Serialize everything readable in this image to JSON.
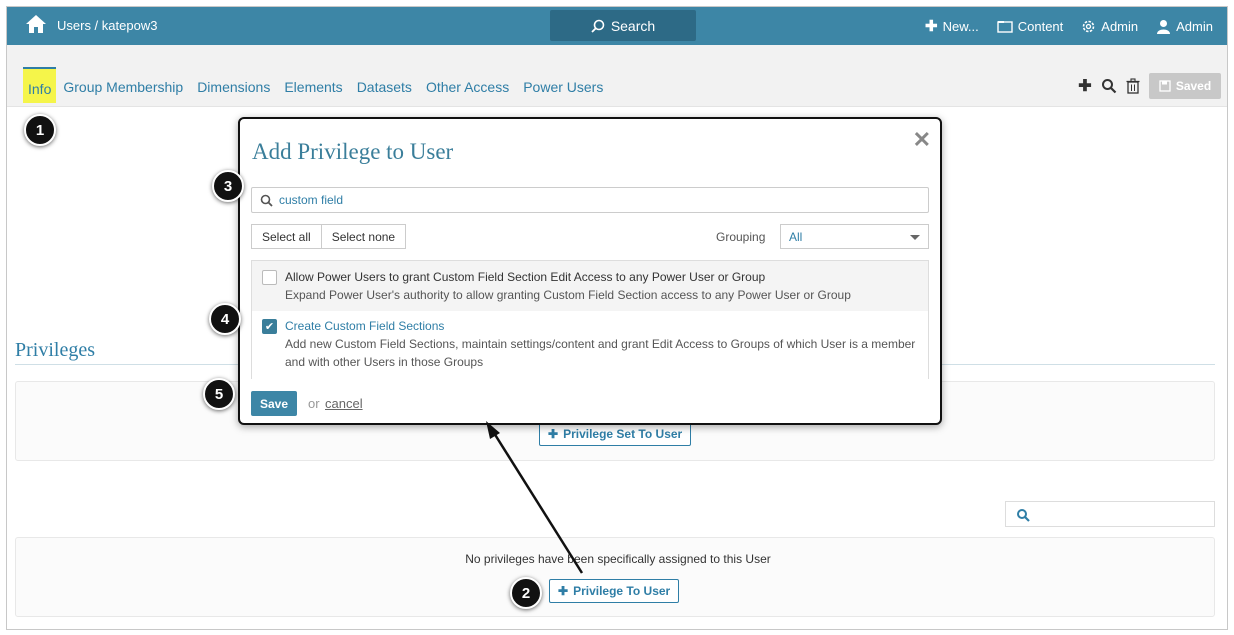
{
  "topbar": {
    "breadcrumb": "Users / katepow3",
    "search_label": "Search",
    "new_label": "New...",
    "content_label": "Content",
    "admin_label": "Admin",
    "user_label": "Admin"
  },
  "tabs": [
    {
      "label": "Info",
      "active": true
    },
    {
      "label": "Group Membership"
    },
    {
      "label": "Dimensions"
    },
    {
      "label": "Elements"
    },
    {
      "label": "Datasets"
    },
    {
      "label": "Other Access"
    },
    {
      "label": "Power Users"
    }
  ],
  "toolbar": {
    "saved_label": "Saved"
  },
  "main": {
    "privileges_title": "Privileges",
    "privilege_set_button": "Privilege Set To User",
    "no_privileges_text": "No privileges have been specifically assigned to this User",
    "privilege_to_user_button": "Privilege To User"
  },
  "modal": {
    "title": "Add Privilege to User",
    "search_value": "custom field",
    "select_all": "Select all",
    "select_none": "Select none",
    "grouping_label": "Grouping",
    "grouping_value": "All",
    "items": [
      {
        "title": "Allow Power Users to grant Custom Field Section Edit Access to any Power User or Group",
        "description": "Expand Power User's authority to allow granting Custom Field Section access to any Power User or Group",
        "checked": false
      },
      {
        "title": "Create Custom Field Sections",
        "description_line1": "Add new Custom Field Sections, maintain settings/content and grant Edit Access to Groups of which User is a member",
        "description_line2": "and with other Users in those Groups",
        "checked": true
      }
    ],
    "save_label": "Save",
    "or_text": "or",
    "cancel_label": "cancel"
  },
  "callouts": [
    "1",
    "2",
    "3",
    "4",
    "5"
  ],
  "colors": {
    "brand": "#3d86a6",
    "highlight": "#f5f54a",
    "link": "#2f7ea6"
  }
}
